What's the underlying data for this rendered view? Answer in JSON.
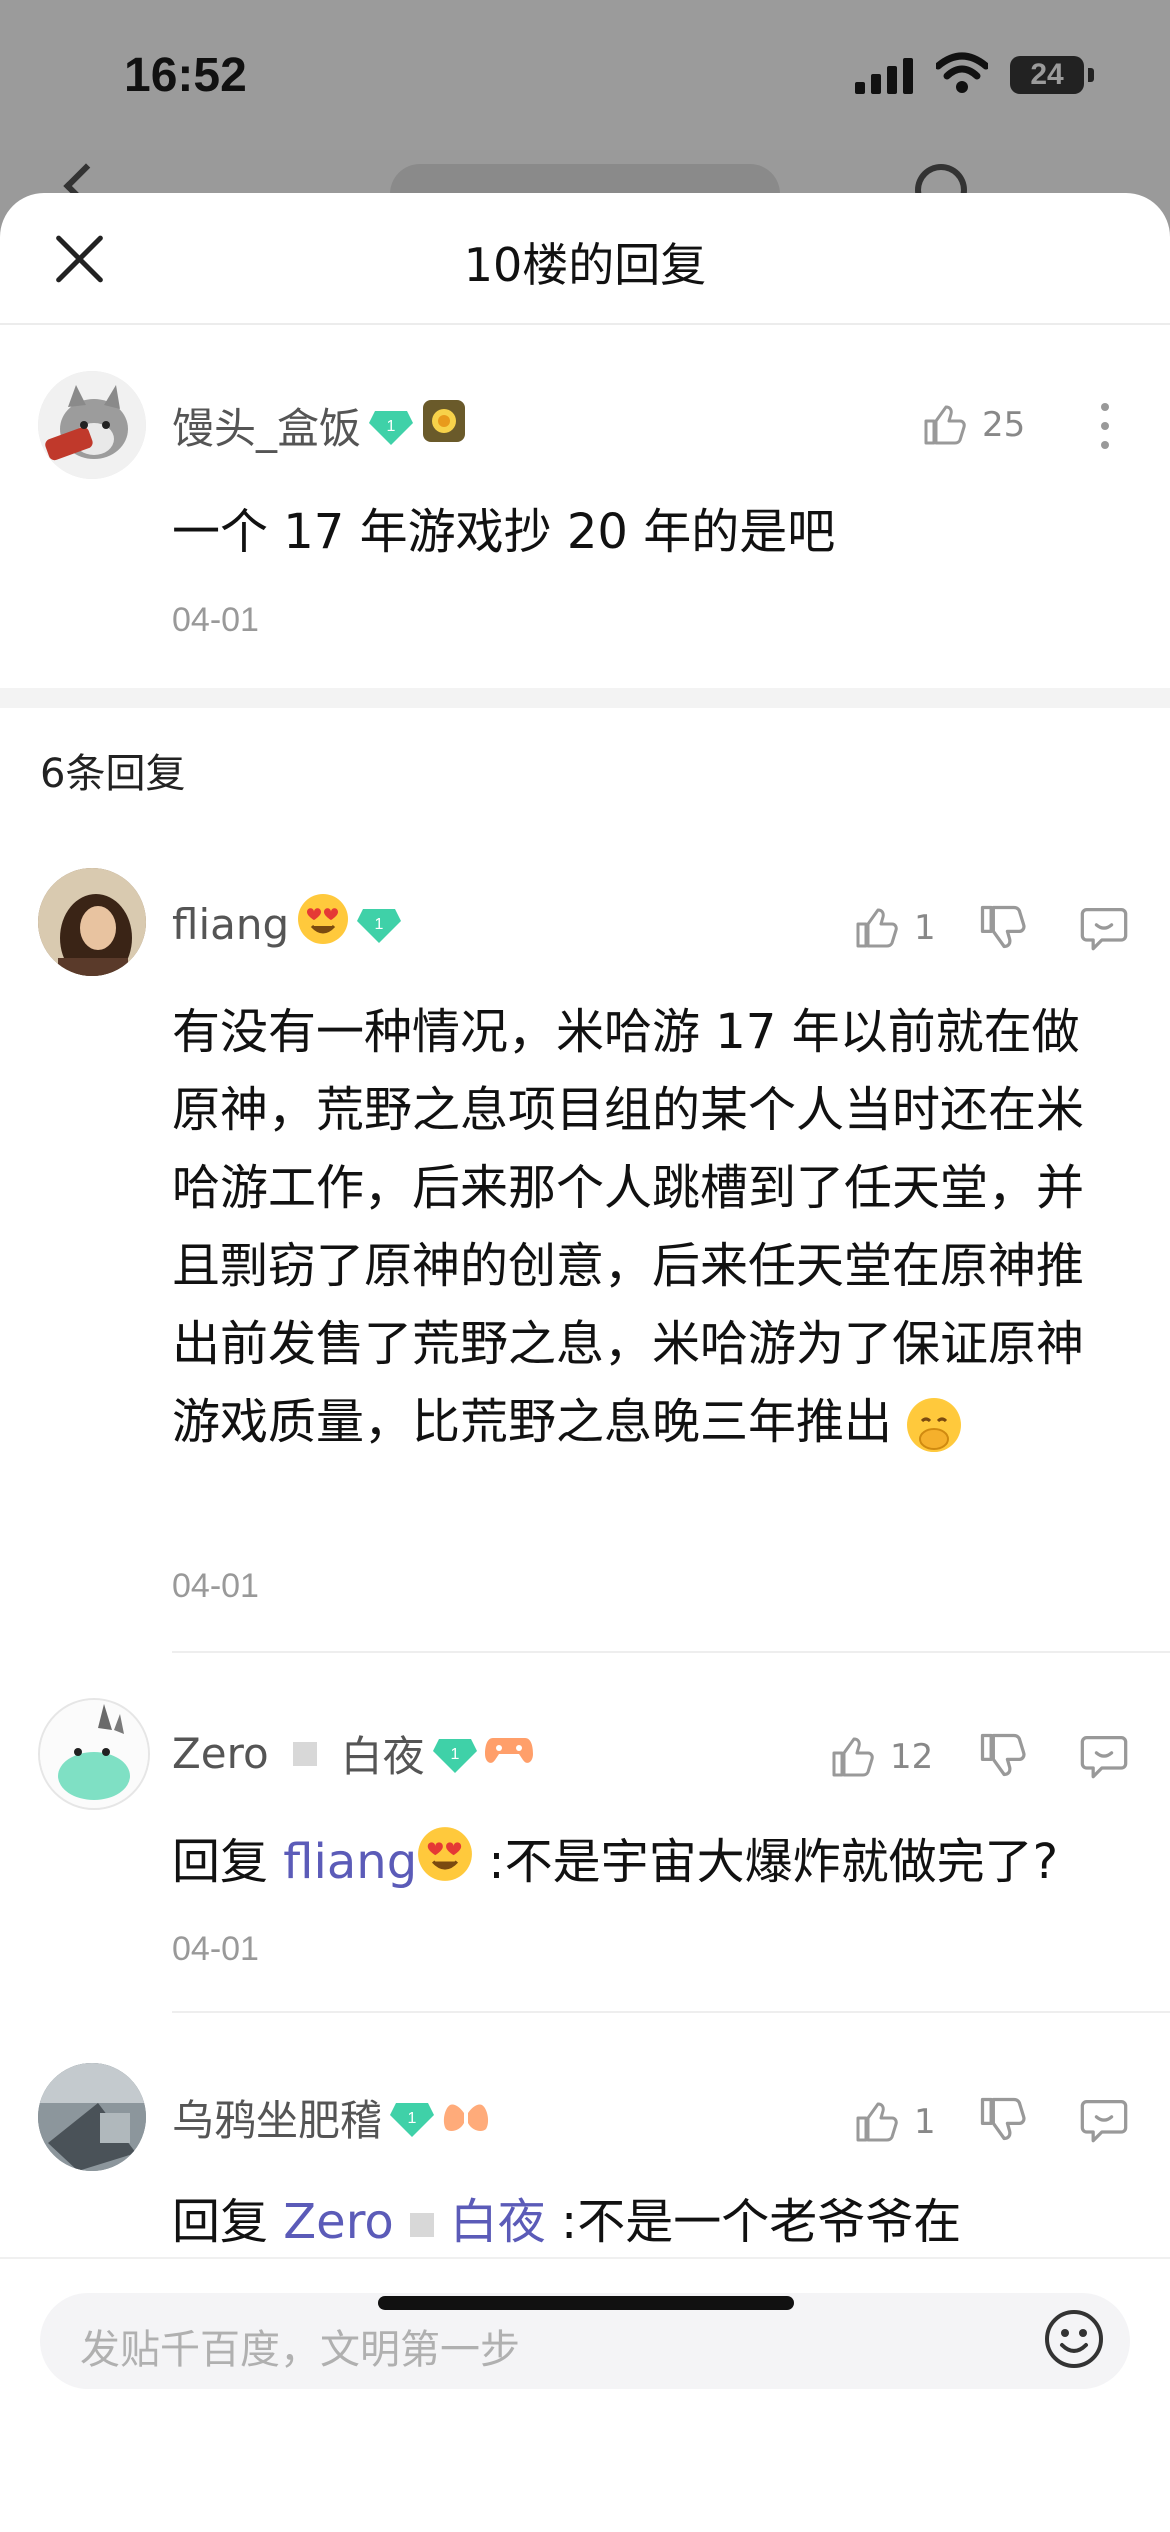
{
  "status": {
    "time": "16:52",
    "battery": "24"
  },
  "sheet": {
    "title": "10楼的回复",
    "replies_count": "6条回复"
  },
  "main_post": {
    "username": "馒头_盒饭",
    "level": "1",
    "likes": "25",
    "text": "一个 17 年游戏抄 20 年的是吧",
    "date": "04-01"
  },
  "replies": [
    {
      "username": "fliang",
      "level": "1",
      "likes": "1",
      "text": "有没有一种情况，米哈游 17 年以前就在做原神，荒野之息项目组的某个人当时还在米哈游工作，后来那个人跳槽到了任天堂，并且剽窃了原神的创意，后来任天堂在原神推出前发售了荒野之息，米哈游为了保证原神游戏质量，比荒野之息晚三年推出",
      "date": "04-01"
    },
    {
      "username": "Zero",
      "username_suffix": "白夜",
      "level": "1",
      "likes": "12",
      "reply_prefix": "回复",
      "reply_to": "fliang",
      "text": ":不是宇宙大爆炸就做完了?",
      "date": "04-01"
    },
    {
      "username": "乌鸦坐肥稽",
      "level": "1",
      "likes": "1",
      "reply_prefix": "回复",
      "reply_to": "Zero",
      "reply_to_suffix": "白夜",
      "text": ":不是一个老爷爷在"
    }
  ],
  "input": {
    "placeholder": "发贴千百度，文明第一步"
  },
  "colors": {
    "mention": "#5b5bb8",
    "level_badge": "#3fd1a8",
    "date": "#999999"
  }
}
